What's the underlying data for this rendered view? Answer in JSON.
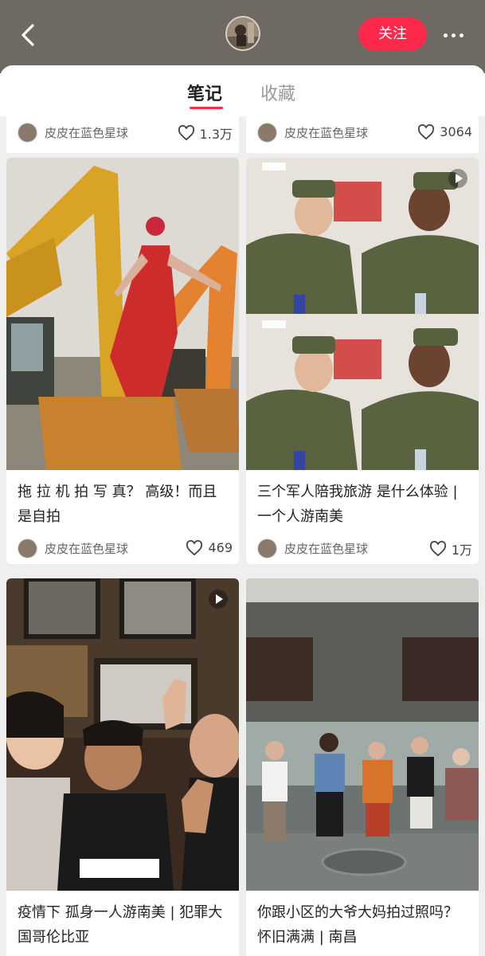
{
  "header": {
    "back_icon": "chevron-left-icon",
    "more_icon": "ellipsis-icon",
    "follow_label": "关注",
    "colors": {
      "header_bg": "#6f6964",
      "accent": "#ff2a4b"
    }
  },
  "tabs": [
    {
      "label": "笔记",
      "active": true
    },
    {
      "label": "收藏",
      "active": false
    }
  ],
  "partial_notes": [
    {
      "author": "皮皮在蓝色星球",
      "likes": "1.3万"
    },
    {
      "author": "皮皮在蓝色星球",
      "likes": "3064"
    }
  ],
  "notes": [
    {
      "title": "拖 拉 机 拍 写 真？ 高级！而且是自拍",
      "author": "皮皮在蓝色星球",
      "likes": "469",
      "image": "woman-on-excavator",
      "video": false
    },
    {
      "title": "三个军人陪我旅游 是什么体验 | 一个人游南美",
      "author": "皮皮在蓝色星球",
      "likes": "1万",
      "image": "soldiers-selfie",
      "video": true
    },
    {
      "title": "疫情下 孤身一人游南美 | 犯罪大国哥伦比亚",
      "image": "friends-waving",
      "video": true
    },
    {
      "title": "你跟小区的大爷大妈拍过照吗？怀旧满满 | 南昌",
      "image": "neighborhood-elders",
      "video": false
    }
  ]
}
